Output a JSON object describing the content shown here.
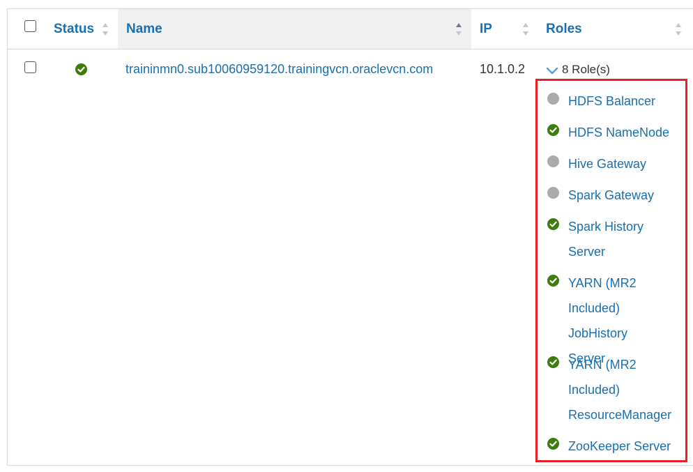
{
  "columns": {
    "status": "Status",
    "name": "Name",
    "ip": "IP",
    "roles": "Roles"
  },
  "row": {
    "name": "traininmn0.sub10060959120.trainingvcn.oraclevcn.com",
    "ip": "10.1.0.2",
    "roles_summary": "8 Role(s)",
    "roles": [
      {
        "label": "HDFS Balancer",
        "status": "grey"
      },
      {
        "label": "HDFS NameNode",
        "status": "ok"
      },
      {
        "label": "Hive Gateway",
        "status": "grey"
      },
      {
        "label": "Spark Gateway",
        "status": "grey"
      },
      {
        "label": "Spark History Server",
        "status": "ok"
      },
      {
        "label": "YARN (MR2 Included) JobHistory Server",
        "status": "ok"
      },
      {
        "label": "YARN (MR2 Included) ResourceManager",
        "status": "ok"
      },
      {
        "label": "ZooKeeper Server",
        "status": "ok"
      }
    ]
  },
  "colors": {
    "link": "#1a6fb0",
    "ok": "#3c7d0c",
    "inactive": "#a9abad",
    "highlight": "#ee1c25"
  }
}
